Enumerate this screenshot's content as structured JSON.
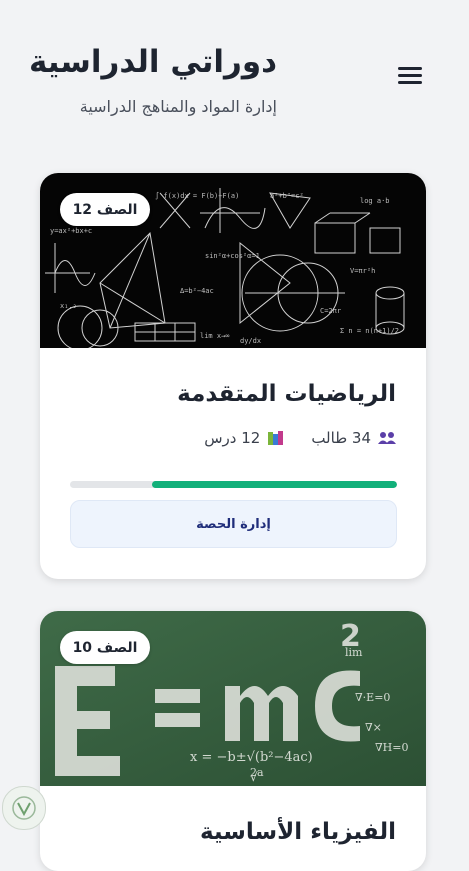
{
  "header": {
    "title": "دوراتي الدراسية",
    "subtitle": "إدارة المواد والمناهج الدراسية",
    "menu_icon": "hamburger-menu-icon"
  },
  "courses": [
    {
      "grade": "الصف 12",
      "title": "الرياضيات المتقدمة",
      "students": "34 طالب",
      "lessons": "12 درس",
      "progress": 0.75,
      "action_label": "إدارة الحصة",
      "image": "math-chalkboard-image"
    },
    {
      "grade": "الصف 10",
      "title": "الفيزياء الأساسية",
      "image": "physics-chalkboard-image"
    }
  ],
  "colors": {
    "background": "#f2f3f5",
    "progress": "#12b07a",
    "button_bg": "#eef4fd",
    "button_text": "#1f2d7a"
  }
}
